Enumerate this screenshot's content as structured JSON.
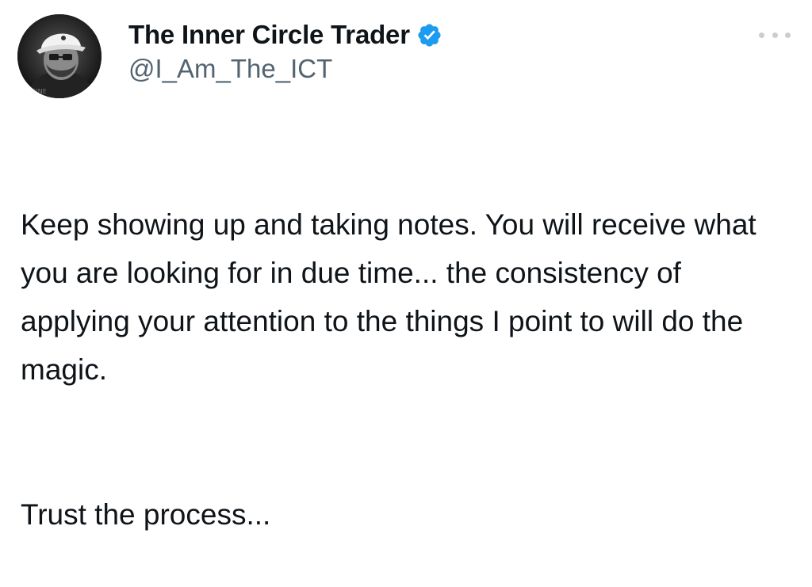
{
  "tweet": {
    "author": {
      "display_name": "The Inner Circle Trader",
      "handle": "@I_Am_The_ICT",
      "verified": true,
      "verified_color": "#1d9bf0",
      "avatar_icon": "profile-photo"
    },
    "more_icon": "more-horizontal-icon",
    "body": {
      "paragraph_1": "Keep showing up and taking notes.  You will receive what you are looking for in due time... the consistency of applying your attention to the things I point to will do the magic.",
      "paragraph_2": "Trust the process..."
    }
  }
}
